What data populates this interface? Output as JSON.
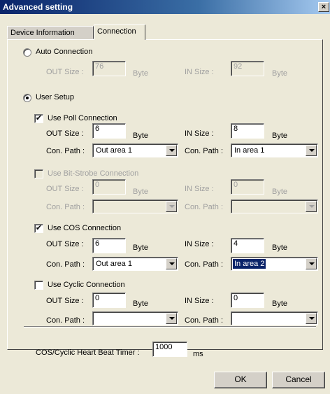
{
  "window": {
    "title": "Advanced setting",
    "close_glyph": "×"
  },
  "tabs": [
    {
      "label": "Device Information",
      "active": false
    },
    {
      "label": "Connection",
      "active": true
    }
  ],
  "auto_connection": {
    "label": "Auto Connection",
    "selected": false,
    "out_size_label": "OUT Size :",
    "out_size": "76",
    "out_unit": "Byte",
    "in_size_label": "IN Size :",
    "in_size": "92",
    "in_unit": "Byte"
  },
  "user_setup": {
    "label": "User Setup",
    "selected": true
  },
  "poll": {
    "label": "Use Poll Connection",
    "checked": true,
    "out_size_label": "OUT Size :",
    "out_size": "6",
    "out_unit": "Byte",
    "in_size_label": "IN Size :",
    "in_size": "8",
    "in_unit": "Byte",
    "out_path_label": "Con. Path :",
    "out_path": "Out area 1",
    "in_path_label": "Con. Path :",
    "in_path": "In area 1"
  },
  "bit_strobe": {
    "label": "Use Bit-Strobe Connection",
    "checked": false,
    "out_size_label": "OUT Size :",
    "out_size": "0",
    "out_unit": "Byte",
    "in_size_label": "IN Size :",
    "in_size": "0",
    "in_unit": "Byte",
    "out_path_label": "Con. Path :",
    "out_path": "",
    "in_path_label": "Con. Path :",
    "in_path": ""
  },
  "cos": {
    "label": "Use COS Connection",
    "checked": true,
    "out_size_label": "OUT Size :",
    "out_size": "6",
    "out_unit": "Byte",
    "in_size_label": "IN Size :",
    "in_size": "4",
    "in_unit": "Byte",
    "out_path_label": "Con. Path :",
    "out_path": "Out area 1",
    "in_path_label": "Con. Path :",
    "in_path": "In area 2"
  },
  "cyclic": {
    "label": "Use Cyclic Connection",
    "checked": false,
    "out_size_label": "OUT Size :",
    "out_size": "0",
    "out_unit": "Byte",
    "in_size_label": "IN Size :",
    "in_size": "0",
    "in_unit": "Byte",
    "out_path_label": "Con. Path :",
    "out_path": "",
    "in_path_label": "Con. Path :",
    "in_path": ""
  },
  "heartbeat": {
    "label": "COS/Cyclic Heart Beat Timer :",
    "value": "1000",
    "unit": "ms"
  },
  "buttons": {
    "ok": "OK",
    "cancel": "Cancel"
  },
  "check_glyph": "✔"
}
